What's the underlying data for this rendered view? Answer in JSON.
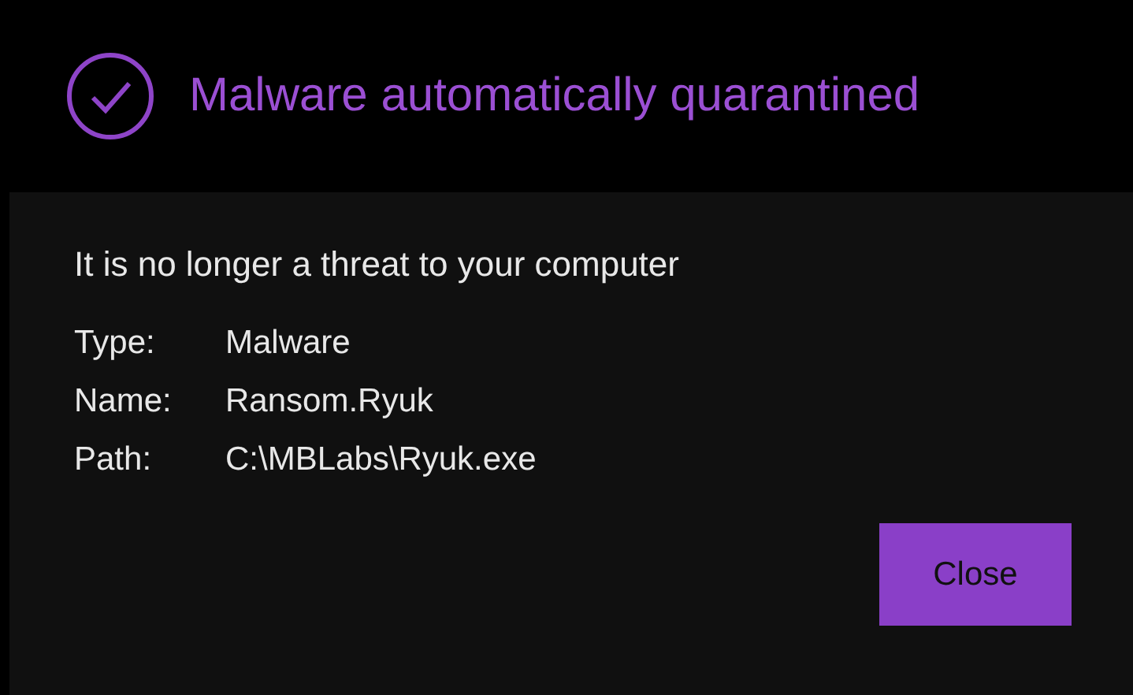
{
  "header": {
    "title": "Malware automatically quarantined"
  },
  "message": "It is no longer a threat to your computer",
  "details": [
    {
      "label": "Type:",
      "value": "Malware"
    },
    {
      "label": "Name:",
      "value": "Ransom.Ryuk"
    },
    {
      "label": "Path:",
      "value": "C:\\MBLabs\\Ryuk.exe"
    }
  ],
  "buttons": [
    "Close"
  ]
}
